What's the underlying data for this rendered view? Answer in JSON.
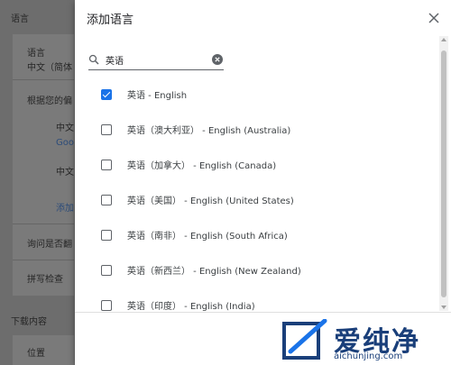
{
  "background": {
    "section1_title": "语言",
    "lang_label": "语言",
    "lang_value": "中文（简体",
    "prefer_text": "根据您的偏",
    "zh_item_a": "中文",
    "zh_item_a_sub": "Goo",
    "zh_item_b": "中文",
    "add_link": "添加",
    "translate_text": "询问是否翻",
    "spellcheck": "拼写检查",
    "section2_title": "下载内容",
    "location": "位置"
  },
  "dialog": {
    "title": "添加语言",
    "search": {
      "value": "英语",
      "placeholder": ""
    },
    "items": [
      {
        "label": "英语 - English",
        "checked": true
      },
      {
        "label": "英语（澳大利亚） - English (Australia)",
        "checked": false
      },
      {
        "label": "英语（加拿大） - English (Canada)",
        "checked": false
      },
      {
        "label": "英语（美国） - English (United States)",
        "checked": false
      },
      {
        "label": "英语（南非） - English (South Africa)",
        "checked": false
      },
      {
        "label": "英语（新西兰） - English (New Zealand)",
        "checked": false
      },
      {
        "label": "英语（印度） - English (India)",
        "checked": false
      }
    ]
  },
  "watermark": {
    "text": "爱纯净",
    "url": "aichunjing.com"
  },
  "colors": {
    "accent": "#1a73e8",
    "overlay": "#6d6d6d"
  }
}
